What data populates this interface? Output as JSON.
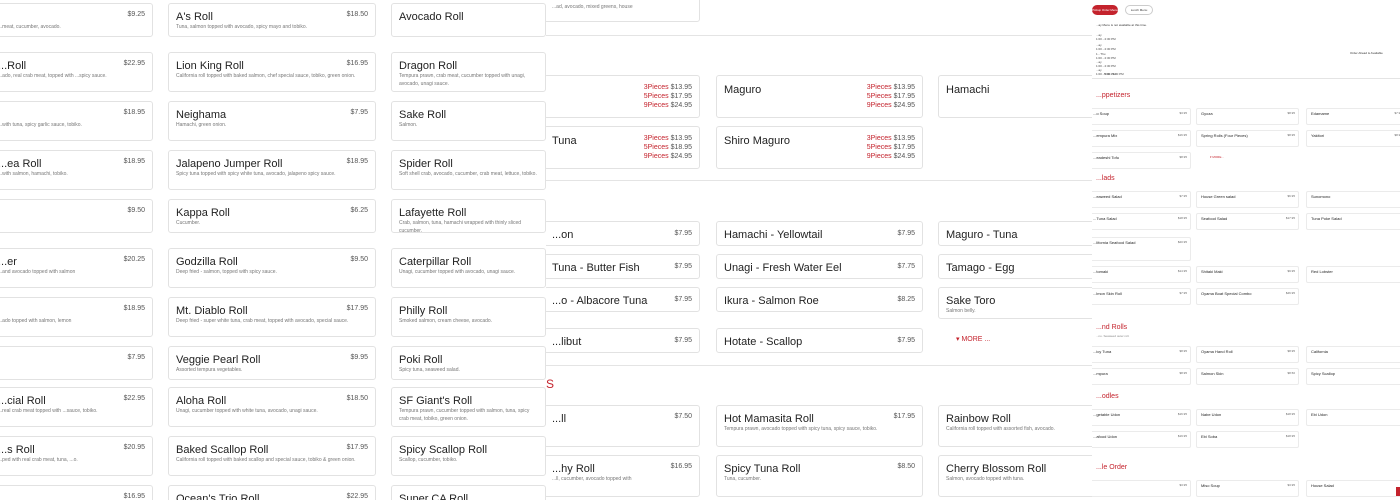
{
  "panel1": {
    "items": [
      {
        "name": "",
        "price": "$9.25",
        "desc": "...meat, cucumber, avocado."
      },
      {
        "name": "A's Roll",
        "price": "$18.50",
        "desc": "Tuna, salmon topped with avocado, spicy mayo and tobiko."
      },
      {
        "name": "Avocado Roll",
        "price": "",
        "desc": ""
      },
      {
        "name": "...Roll",
        "price": "$22.95",
        "desc": "...ado, real crab meat, topped with ...spicy sauce."
      },
      {
        "name": "Lion King Roll",
        "price": "$16.95",
        "desc": "California roll topped with baked salmon, chef special sauce, tobiko, green onion."
      },
      {
        "name": "Dragon Roll",
        "price": "",
        "desc": "Tempura prawn, crab meat, cucumber topped with unagi, avocado, unagi sauce."
      },
      {
        "name": "",
        "price": "$18.95",
        "desc": "...with tuna, spicy garlic sauce, tobiko."
      },
      {
        "name": "Neighama",
        "price": "$7.95",
        "desc": "Hamachi, green onion."
      },
      {
        "name": "Sake Roll",
        "price": "",
        "desc": "Salmon."
      },
      {
        "name": "...ea Roll",
        "price": "$18.95",
        "desc": "...with salmon, hamachi, tobiko."
      },
      {
        "name": "Jalapeno Jumper Roll",
        "price": "$18.95",
        "desc": "Spicy tuna topped with spicy white tuna, avocado, jalapeno spicy sauce."
      },
      {
        "name": "Spider Roll",
        "price": "",
        "desc": "Soft shell crab, avocado, cucumber, crab meat, lettuce, tobiko."
      },
      {
        "name": "",
        "price": "$9.50",
        "desc": ""
      },
      {
        "name": "Kappa Roll",
        "price": "$6.25",
        "desc": "Cucumber."
      },
      {
        "name": "Lafayette Roll",
        "price": "",
        "desc": "Crab, salmon, tuna, hamachi wrapped with thinly sliced cucumber."
      },
      {
        "name": "...er",
        "price": "$20.25",
        "desc": "...and avocado topped with salmon"
      },
      {
        "name": "Godzilla Roll",
        "price": "$9.50",
        "desc": "Deep fried - salmon, topped with spicy sauce."
      },
      {
        "name": "Caterpillar Roll",
        "price": "",
        "desc": "Unagi, cucumber topped with avocado, unagi sauce."
      },
      {
        "name": "",
        "price": "$18.95",
        "desc": "...ado topped with salmon, lemon"
      },
      {
        "name": "Mt. Diablo Roll",
        "price": "$17.95",
        "desc": "Deep fried - super white tuna, crab meat, topped with avocado, special sauce."
      },
      {
        "name": "Philly Roll",
        "price": "",
        "desc": "Smoked salmon, cream cheese, avocado."
      },
      {
        "name": "",
        "price": "$7.95",
        "desc": ""
      },
      {
        "name": "Veggie Pearl Roll",
        "price": "$9.95",
        "desc": "Assorted tempura vegetables."
      },
      {
        "name": "Poki Roll",
        "price": "",
        "desc": "Spicy tuna, seaweed salad."
      },
      {
        "name": "...cial Roll",
        "price": "$22.95",
        "desc": "...real crab meat topped with ...sauce, tobiko."
      },
      {
        "name": "Aloha Roll",
        "price": "$18.50",
        "desc": "Unagi, cucumber topped with white tuna, avocado, unagi sauce."
      },
      {
        "name": "SF Giant's Roll",
        "price": "",
        "desc": "Tempura prawn, cucumber topped with salmon, tuna, spicy crab meat, tobiko, green onion."
      },
      {
        "name": "...s Roll",
        "price": "$20.95",
        "desc": "...ped with real crab meat, tuna, ...o."
      },
      {
        "name": "Baked Scallop Roll",
        "price": "$17.95",
        "desc": "California roll topped with baked scallop and special sauce, tobiko & green onion."
      },
      {
        "name": "Spicy Scallop Roll",
        "price": "",
        "desc": "Scallop, cucumber, tobiko."
      },
      {
        "name": "",
        "price": "$16.95",
        "desc": ""
      },
      {
        "name": "Ocean's Trio Roll",
        "price": "$22.95",
        "desc": ""
      },
      {
        "name": "Super CA Roll",
        "price": "",
        "desc": ""
      }
    ]
  },
  "panel2": {
    "top_desc": "...ad, avocado, mixed greens, house",
    "pieces": [
      {
        "name": "",
        "q1": "3Pieces",
        "p1": "$13.95",
        "q2": "5Pieces",
        "p2": "$17.95",
        "q3": "9Pieces",
        "p3": "$24.95"
      },
      {
        "name": "Maguro",
        "q1": "3Pieces",
        "p1": "$13.95",
        "q2": "5Pieces",
        "p2": "$17.95",
        "q3": "9Pieces",
        "p3": "$24.95"
      },
      {
        "name": "Hamachi",
        "q1": "",
        "p1": "",
        "q2": "",
        "p2": "",
        "q3": "",
        "p3": ""
      },
      {
        "name": "Tuna",
        "q1": "3Pieces",
        "p1": "$13.95",
        "q2": "5Pieces",
        "p2": "$18.95",
        "q3": "9Pieces",
        "p3": "$24.95"
      },
      {
        "name": "Shiro Maguro",
        "q1": "3Pieces",
        "p1": "$13.95",
        "q2": "5Pieces",
        "p2": "$17.95",
        "q3": "9Pieces",
        "p3": "$24.95"
      }
    ],
    "nigiri": [
      {
        "name": "...on",
        "price": "$7.95"
      },
      {
        "name": "Hamachi - Yellowtail",
        "price": "$7.95"
      },
      {
        "name": "Maguro - Tuna",
        "price": ""
      },
      {
        "name": "Tuna - Butter Fish",
        "price": "$7.95"
      },
      {
        "name": "Unagi - Fresh Water Eel",
        "price": "$7.75"
      },
      {
        "name": "Tamago - Egg",
        "price": ""
      },
      {
        "name": "...o - Albacore Tuna",
        "price": "$7.95"
      },
      {
        "name": "Ikura - Salmon Roe",
        "price": "$8.25"
      },
      {
        "name": "Sake Toro",
        "price": "",
        "desc": "Salmon belly."
      },
      {
        "name": "...libut",
        "price": "$7.95"
      },
      {
        "name": "Hotate - Scallop",
        "price": "$7.95"
      }
    ],
    "more": "▾ MORE ...",
    "section_tail": "S",
    "rolls": [
      {
        "name": "...ll",
        "price": "$7.50",
        "desc": ""
      },
      {
        "name": "Hot Mamasita Roll",
        "price": "$17.95",
        "desc": "Tempura prawn, avocado topped with spicy tuna, spicy sauce, tobiko."
      },
      {
        "name": "Rainbow Roll",
        "price": "",
        "desc": "California roll topped with assorted fish, avocado."
      },
      {
        "name": "...hy Roll",
        "price": "$16.95",
        "desc": "...ll, cucumber, avocado topped with"
      },
      {
        "name": "Spicy Tuna Roll",
        "price": "$8.50",
        "desc": "Tuna, cucumber."
      },
      {
        "name": "Cherry Blossom Roll",
        "price": "",
        "desc": "Salmon, avocado topped with tuna."
      }
    ]
  },
  "panel3": {
    "btn_order": "Pickup Order Menu",
    "btn_lunch": "Lunch Menu",
    "notice": "...ay Menu is not available at this time.",
    "hours": [
      "...ay",
      "1:00 - 2:30 PM",
      "...ay",
      "1:00 - 2:30 PM",
      "1 - Thu",
      "1:00 - 2:30 PM",
      "...ay",
      "1:00 - 2:30 PM",
      "...ay",
      "1:00 - 2:30 PM",
      "5:00 - 9:30 PM"
    ],
    "order_ahead": "Order Ahead is Available",
    "sections": [
      {
        "title": "...ppetizers",
        "sub": "",
        "items": [
          {
            "n": "...o Soup",
            "p": "$3.95",
            "d": ""
          },
          {
            "n": "Gyoza",
            "p": "$8.95",
            "d": ""
          },
          {
            "n": "Edamame",
            "p": "$7.95",
            "d": ""
          },
          {
            "n": "...empura Mix",
            "p": "$16.95",
            "d": ""
          },
          {
            "n": "Spring Rolls (Four Pieces)",
            "p": "$8.95",
            "d": ""
          },
          {
            "n": "Yakitori",
            "p": "$8.95",
            "d": ""
          },
          {
            "n": "...eadeshi Tofu",
            "p": "$8.95",
            "d": ""
          },
          {
            "n": "▾ MORE...",
            "p": "",
            "d": ""
          }
        ]
      },
      {
        "title": "...lads",
        "sub": "",
        "items": [
          {
            "n": "...eaweed Salad",
            "p": "$7.95",
            "d": ""
          },
          {
            "n": "House Green salad",
            "p": "$6.95",
            "d": ""
          },
          {
            "n": "Sunomono",
            "p": "",
            "d": ""
          },
          {
            "n": "...Tuna Salad",
            "p": "$18.95",
            "d": ""
          },
          {
            "n": "Seafood Salad",
            "p": "$17.95",
            "d": ""
          },
          {
            "n": "Tuna Poke Salad",
            "p": "",
            "d": ""
          },
          {
            "n": "...lifornia Seafood Salad",
            "p": "$20.95",
            "d": ""
          },
          {
            "n": "",
            "p": "",
            "d": ""
          },
          {
            "n": "",
            "p": "",
            "d": ""
          },
          {
            "n": "...tomaki",
            "p": "$14.95",
            "d": ""
          },
          {
            "n": "Shitaki Maki",
            "p": "$9.95",
            "d": ""
          },
          {
            "n": "Red Lobster",
            "p": "",
            "d": ""
          },
          {
            "n": "...lmon Skin Roll",
            "p": "$7.95",
            "d": ""
          },
          {
            "n": "Oyama Boat Special Combo",
            "p": "$46.95",
            "d": ""
          }
        ]
      },
      {
        "title": "...nd Rolls",
        "sub": "...no. Seaweed outer roll.",
        "items": [
          {
            "n": "...icy Tuna",
            "p": "$8.95",
            "d": ""
          },
          {
            "n": "Oyama Hand Roll",
            "p": "$8.95",
            "d": ""
          },
          {
            "n": "California",
            "p": "",
            "d": ""
          },
          {
            "n": "...mpura",
            "p": "$8.95",
            "d": ""
          },
          {
            "n": "Salmon Skin",
            "p": "$8.50",
            "d": ""
          },
          {
            "n": "Spicy Scallop",
            "p": "",
            "d": ""
          }
        ]
      },
      {
        "title": "...odles",
        "sub": "",
        "items": [
          {
            "n": "...getable Udon",
            "p": "$16.95",
            "d": ""
          },
          {
            "n": "Nabe Udon",
            "p": "$18.95",
            "d": ""
          },
          {
            "n": "Ebi Udon",
            "p": "",
            "d": ""
          },
          {
            "n": "...afood Udon",
            "p": "$19.95",
            "d": ""
          },
          {
            "n": "Ebi Soba",
            "p": "$18.95",
            "d": ""
          },
          {
            "n": "",
            "p": "",
            "d": ""
          }
        ]
      },
      {
        "title": "...le Order",
        "sub": "",
        "items": [
          {
            "n": "",
            "p": "$3.95",
            "d": ""
          },
          {
            "n": "Miso Soup",
            "p": "$3.95",
            "d": ""
          },
          {
            "n": "House Salad",
            "p": "",
            "d": ""
          }
        ]
      }
    ]
  }
}
